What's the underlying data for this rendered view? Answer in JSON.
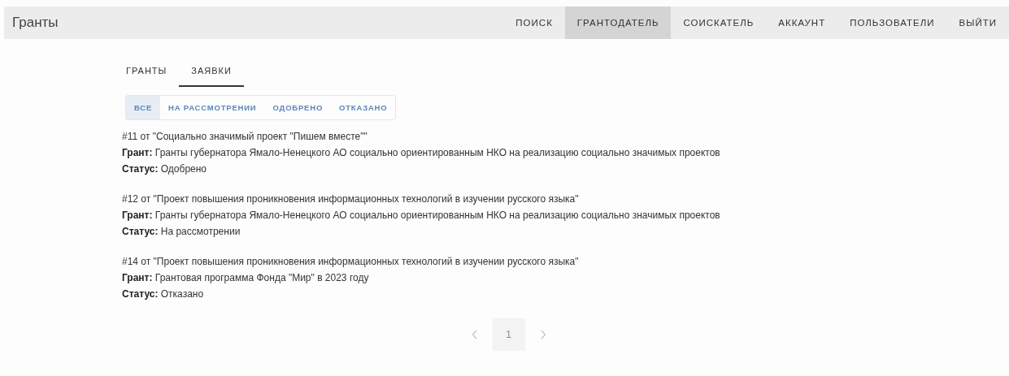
{
  "app_bar": {
    "title": "Гранты",
    "nav": [
      {
        "label": "ПОИСК",
        "selected": false
      },
      {
        "label": "ГРАНТОДАТЕЛЬ",
        "selected": true
      },
      {
        "label": "СОИСКАТЕЛЬ",
        "selected": false
      },
      {
        "label": "АККАУНТ",
        "selected": false
      },
      {
        "label": "ПОЛЬЗОВАТЕЛИ",
        "selected": false
      },
      {
        "label": "ВЫЙТИ",
        "selected": false
      }
    ]
  },
  "tabs": [
    {
      "label": "ГРАНТЫ",
      "selected": false
    },
    {
      "label": "ЗАЯВКИ",
      "selected": true
    }
  ],
  "filters": [
    {
      "label": "ВСЕ",
      "selected": true
    },
    {
      "label": "НА РАССМОТРЕНИИ",
      "selected": false
    },
    {
      "label": "ОДОБРЕНО",
      "selected": false
    },
    {
      "label": "ОТКАЗАНО",
      "selected": false
    }
  ],
  "applications": [
    {
      "title": "#11 от \"Социально значимый проект \"Пишем вместе\"\"",
      "grant": "**Грант:** Гранты губернатора Ямало-Ненецкого АО социально ориентированным НКО на реализацию социально значимых проектов",
      "status": "**Статус:** Одобрено"
    },
    {
      "title": "#12 от \"Проект повышения проникновения информационных технологий в изучении русского языка\"",
      "grant": "**Грант:** Гранты губернатора Ямало-Ненецкого АО социально ориентированным НКО на реализацию социально значимых проектов",
      "status": "**Статус:** На рассмотрении"
    },
    {
      "title": "#14 от \"Проект повышения проникновения информационных технологий в изучении русского языка\"",
      "grant": "**Грант:** Грантовая программа Фонда \"Мир\" в 2023 году",
      "status": "**Статус:** Отказано"
    }
  ],
  "pagination": {
    "prev_disabled": true,
    "next_disabled": true,
    "pages": [
      {
        "label": "1",
        "selected": true
      }
    ]
  }
}
